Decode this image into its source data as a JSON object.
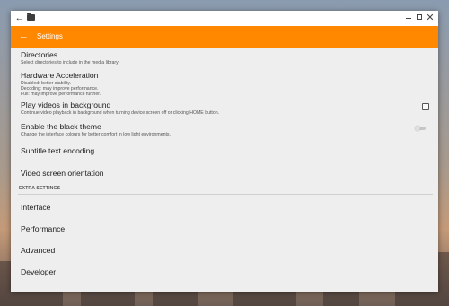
{
  "titlebar": {
    "back_icon": "arrow-left-icon",
    "app_icon": "folder-icon",
    "minimize_icon": "minimize-icon",
    "maximize_icon": "maximize-icon",
    "close_icon": "close-icon"
  },
  "appbar": {
    "back_icon": "arrow-left-icon",
    "title": "Settings",
    "color": "#ff8800"
  },
  "settings": [
    {
      "title": "Directories",
      "subtitle": "Select directories to include in the media library"
    },
    {
      "title": "Hardware Acceleration",
      "subtitle_lines": [
        "Disabled: better stability.",
        "Decoding: may improve performance.",
        "Full: may improve performance further."
      ]
    },
    {
      "title": "Play videos in background",
      "subtitle": "Continue video playback in background when turning device screen off or clicking HOME button.",
      "checked": false
    },
    {
      "title": "Enable the black theme",
      "subtitle": "Change the interface colours for better comfort in low light environments.",
      "enabled": false
    },
    {
      "title": "Subtitle text encoding"
    },
    {
      "title": "Video screen orientation"
    }
  ],
  "extra_section": {
    "header": "EXTRA SETTINGS",
    "items": [
      {
        "title": "Interface"
      },
      {
        "title": "Performance"
      },
      {
        "title": "Advanced"
      },
      {
        "title": "Developer"
      }
    ]
  }
}
